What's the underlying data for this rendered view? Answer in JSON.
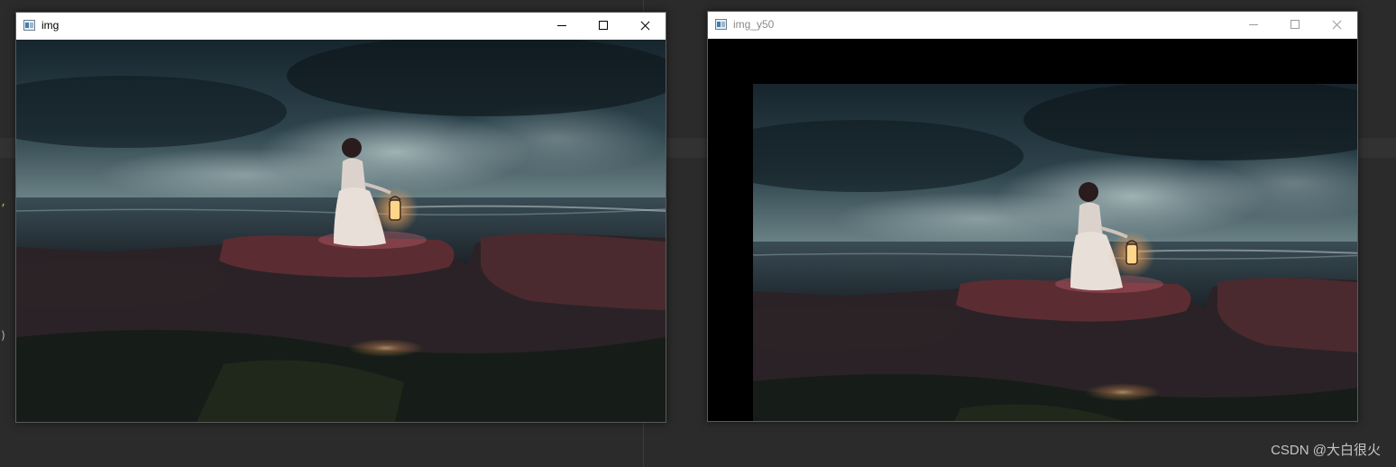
{
  "background_editor": {
    "fragments": [
      ",",
      ")"
    ]
  },
  "windows": [
    {
      "title": "img",
      "state": "active",
      "icon": "window-app-icon",
      "controls": [
        "minimize-icon",
        "maximize-icon",
        "close-icon"
      ],
      "image": "girl kneeling on a rock by the sea holding a glowing lantern under a stormy sky"
    },
    {
      "title": "img_y50",
      "state": "inactive",
      "icon": "window-app-icon",
      "controls": [
        "minimize-icon",
        "maximize-icon",
        "close-icon"
      ],
      "image": "same picture translated right and down with black fill in the uncovered area"
    }
  ],
  "watermark": "CSDN @大白很火",
  "colors": {
    "editor_background": "#2b2b2b",
    "titlebar_active": "#ffffff",
    "titlebar_text_inactive": "#8a8a8a",
    "image_fill": "#000000"
  }
}
